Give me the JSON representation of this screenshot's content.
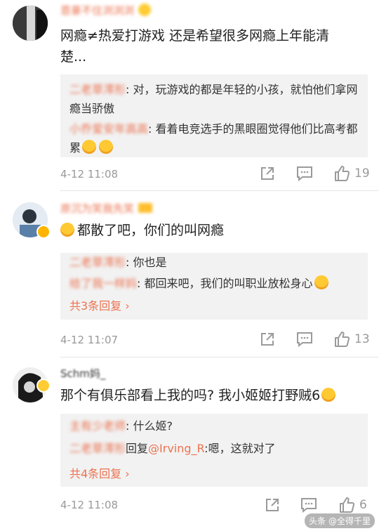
{
  "comments": [
    {
      "username": "恩豪不住浏浏浏",
      "text": "网瘾≠热爱打游戏 还是希望很多网瘾上年能清楚...",
      "replies": [
        {
          "user": "二老草澪形",
          "text": ": 对，玩游戏的都是年轻的小孩，就怕他们拿网瘾当骄傲"
        },
        {
          "user": "小乔爱安年高高",
          "text": ": 看着电竞选手的黑眼圈觉得他们比高考都累"
        }
      ],
      "time": "4-12 11:08",
      "likes": "19"
    },
    {
      "username": "原沉为笑我先笑",
      "text": "都散了吧，你们的叫网瘾",
      "replies": [
        {
          "user": "二老草澪形",
          "text": ": 你也是"
        },
        {
          "user": "给了我一样妈",
          "text": ": 都回来吧，我们的叫职业放松身心"
        }
      ],
      "more": "共3条回复",
      "time": "4-12 11:07",
      "likes": "13"
    },
    {
      "username": "Schm妈_",
      "text": "那个有俱乐部看上我的吗? 我小姬姬打野贼6",
      "replies": [
        {
          "user": "主有少老师",
          "text": ": 什么姬?"
        },
        {
          "user": "二老草澪形",
          "pre": "回复",
          "at": "@Irving_R",
          "text": ":嗯，这就对了"
        }
      ],
      "more": "共4条回复",
      "time": "4-12 11:08",
      "likes": "6"
    }
  ],
  "watermark": "头条 @全得千里",
  "colors": {
    "accent": "#eb7350",
    "meta": "#999999",
    "reply_bg": "#f2f2f2"
  }
}
